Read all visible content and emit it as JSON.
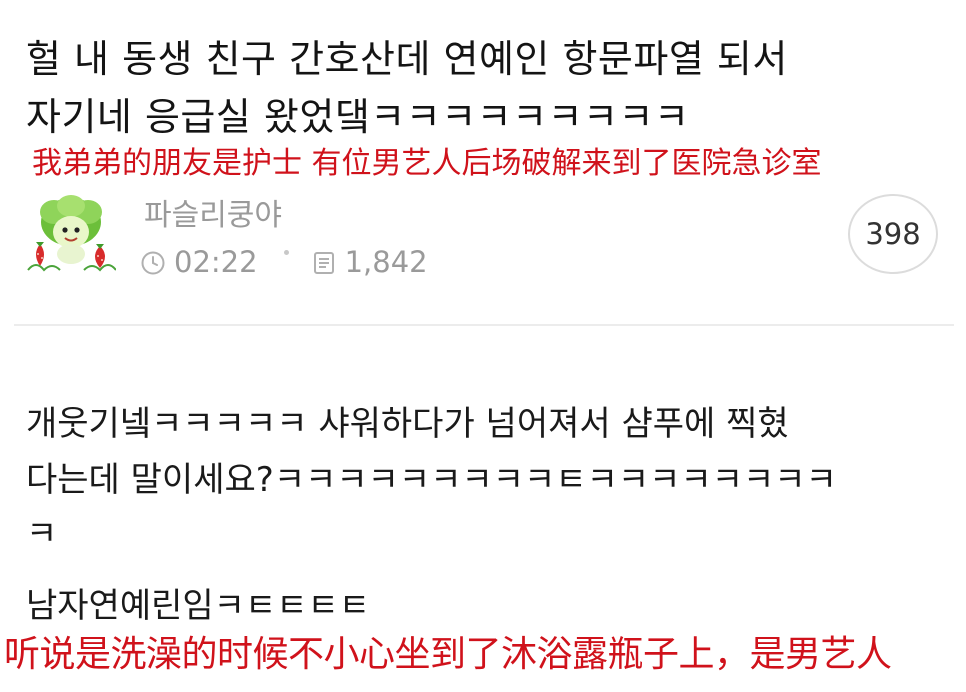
{
  "post": {
    "title_line_1": "헐 내 동생 친구 간호산데 연예인 항문파열 되서",
    "title_line_2": "자기네 응급실 왔었댘ㅋㅋㅋㅋㅋㅋㅋㅋㅋ",
    "caption": "我弟弟的朋友是护士 有位男艺人后场破解来到了医院急诊室",
    "author": "파슬리쿵야",
    "time": "02:22",
    "views": "1,842",
    "comment_count": "398"
  },
  "comment": {
    "line_1": "개웃기넼ㅋㅋㅋㅋㅋ 샤워하다가 넘어져서 샴푸에 찍혔",
    "line_2": "다는데 말이세요?ㅋㅋㅋㅋㅋㅋㅋㅋㅋㅌㅋㅋㅋㅋㅋㅋㅋㅋ",
    "line_3": "ㅋ",
    "line_4": "남자연예린임ㅋㅌㅌㅌㅌ",
    "caption": "听说是洗澡的时候不小心坐到了沐浴露瓶子上，是男艺人"
  },
  "icons": {
    "avatar": "cabbage-character-avatar",
    "time": "clock-icon",
    "views": "document-icon"
  },
  "colors": {
    "caption_red": "#d0121b",
    "meta_gray": "#9a9a9a",
    "text_dark": "#1a1a1a"
  }
}
